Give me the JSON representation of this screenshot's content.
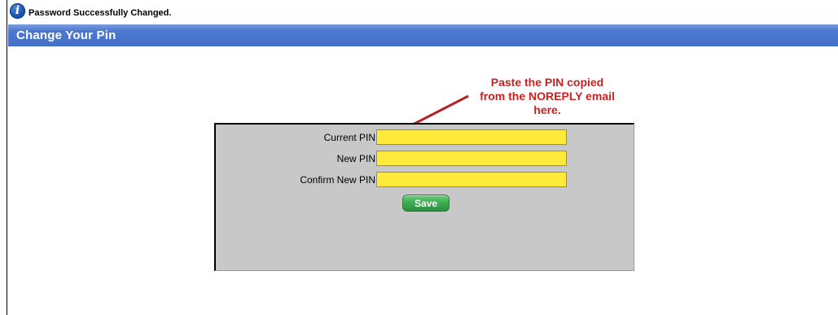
{
  "notice": {
    "icon": "info-icon",
    "icon_glyph": "i",
    "text": "Password Successfully Changed."
  },
  "header": {
    "title": "Change Your Pin"
  },
  "annotation": {
    "line1": "Paste the PIN copied",
    "line2": "from the NOREPLY email",
    "line3": "here.",
    "color": "#cc1f1f"
  },
  "form": {
    "fields": [
      {
        "label": "Current PIN",
        "value": ""
      },
      {
        "label": "New PIN",
        "value": ""
      },
      {
        "label": "Confirm New PIN",
        "value": ""
      }
    ],
    "save_label": "Save",
    "input_color": "#ffe93a",
    "panel_color": "#c8c8c8"
  },
  "colors": {
    "header_bar": "#4470c8",
    "save_button": "#3fae52"
  }
}
